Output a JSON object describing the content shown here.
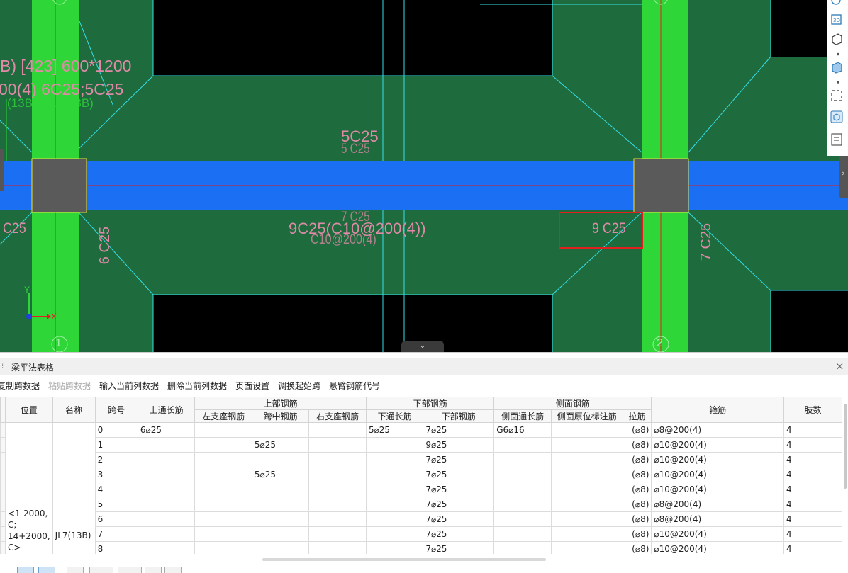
{
  "canvas": {
    "beam_label_line1": "B) [423] 600*1200",
    "beam_label_line2": "00(4) 6C25;5C25",
    "beam_label_ghost": "(13B)  F(U)(13B)",
    "top_span_label": "5C25",
    "top_span_label_ghost": "5 C25",
    "bottom_span_label": "9C25(C10@200(4))",
    "bottom_span_ghost_1": "7 C25",
    "bottom_span_ghost_2": "C10@200(4)",
    "highlighted_label": "9 C25",
    "left_ghost_label": "C25",
    "left_vertical_label": "6 C25",
    "right_vertical_label": "7 C25",
    "axis_y": "Y",
    "axis_x": "X",
    "grid_axis_1": "1",
    "grid_axis_2": "2",
    "colors": {
      "background": "#000000",
      "slab": "#1e6b3e",
      "column_strip": "#2ed637",
      "beam": "#1b6ff2",
      "column": "#5a5a5a",
      "line": "#35e0e8",
      "text": "#e08aa8",
      "highlight": "#e02020"
    }
  },
  "toolbar_right": {
    "icons": [
      "sphere-icon",
      "3d-view-icon",
      "cube-icon",
      "cube-shaded-icon",
      "frame-select-icon",
      "component-icon",
      "list-icon"
    ],
    "label_3d": "3D"
  },
  "panel": {
    "title": "梁平法表格",
    "close": "×",
    "toolbar": [
      {
        "label": "复制跨数据",
        "disabled": false
      },
      {
        "label": "粘贴跨数据",
        "disabled": true
      },
      {
        "label": "输入当前列数据",
        "disabled": false
      },
      {
        "label": "删除当前列数据",
        "disabled": false
      },
      {
        "label": "页面设置",
        "disabled": false
      },
      {
        "label": "调换起始跨",
        "disabled": false
      },
      {
        "label": "悬臂钢筋代号",
        "disabled": false
      }
    ]
  },
  "table": {
    "headers": {
      "position": "位置",
      "name": "名称",
      "span": "跨号",
      "top_through": "上通长筋",
      "top_group": "上部钢筋",
      "left_support": "左支座钢筋",
      "mid_span": "跨中钢筋",
      "right_support": "右支座钢筋",
      "bottom_group": "下部钢筋",
      "bottom_through": "下通长筋",
      "bottom_bars": "下部钢筋",
      "side_group": "侧面钢筋",
      "side_through": "侧面通长筋",
      "side_in_situ": "侧面原位标注筋",
      "tie": "拉筋",
      "stirrup": "箍筋",
      "legs": "肢数"
    },
    "position_value": "<1-2000, C; 14+2000, C>",
    "name_value": "JL7(13B)",
    "rows": [
      {
        "span": "0",
        "top": "6⌀25",
        "left": "",
        "mid": "",
        "right": "",
        "b_through": "5⌀25",
        "bottom": "7⌀25",
        "side": "G6⌀16",
        "side_in": "",
        "tie": "(⌀8)",
        "stirrup": "⌀8@200(4)",
        "legs": "4"
      },
      {
        "span": "1",
        "top": "",
        "left": "",
        "mid": "5⌀25",
        "right": "",
        "b_through": "",
        "bottom": "9⌀25",
        "side": "",
        "side_in": "",
        "tie": "(⌀8)",
        "stirrup": "⌀10@200(4)",
        "legs": "4"
      },
      {
        "span": "2",
        "top": "",
        "left": "",
        "mid": "",
        "right": "",
        "b_through": "",
        "bottom": "7⌀25",
        "side": "",
        "side_in": "",
        "tie": "(⌀8)",
        "stirrup": "⌀10@200(4)",
        "legs": "4"
      },
      {
        "span": "3",
        "top": "",
        "left": "",
        "mid": "5⌀25",
        "right": "",
        "b_through": "",
        "bottom": "7⌀25",
        "side": "",
        "side_in": "",
        "tie": "(⌀8)",
        "stirrup": "⌀10@200(4)",
        "legs": "4"
      },
      {
        "span": "4",
        "top": "",
        "left": "",
        "mid": "",
        "right": "",
        "b_through": "",
        "bottom": "7⌀25",
        "side": "",
        "side_in": "",
        "tie": "(⌀8)",
        "stirrup": "⌀10@200(4)",
        "legs": "4"
      },
      {
        "span": "5",
        "top": "",
        "left": "",
        "mid": "",
        "right": "",
        "b_through": "",
        "bottom": "7⌀25",
        "side": "",
        "side_in": "",
        "tie": "(⌀8)",
        "stirrup": "⌀8@200(4)",
        "legs": "4"
      },
      {
        "span": "6",
        "top": "",
        "left": "",
        "mid": "",
        "right": "",
        "b_through": "",
        "bottom": "7⌀25",
        "side": "",
        "side_in": "",
        "tie": "(⌀8)",
        "stirrup": "⌀8@200(4)",
        "legs": "4"
      },
      {
        "span": "7",
        "top": "",
        "left": "",
        "mid": "",
        "right": "",
        "b_through": "",
        "bottom": "7⌀25",
        "side": "",
        "side_in": "",
        "tie": "(⌀8)",
        "stirrup": "⌀10@200(4)",
        "legs": "4"
      },
      {
        "span": "8",
        "top": "",
        "left": "",
        "mid": "",
        "right": "",
        "b_through": "",
        "bottom": "7⌀25",
        "side": "",
        "side_in": "",
        "tie": "(⌀8)",
        "stirrup": "⌀10@200(4)",
        "legs": "4"
      }
    ]
  }
}
